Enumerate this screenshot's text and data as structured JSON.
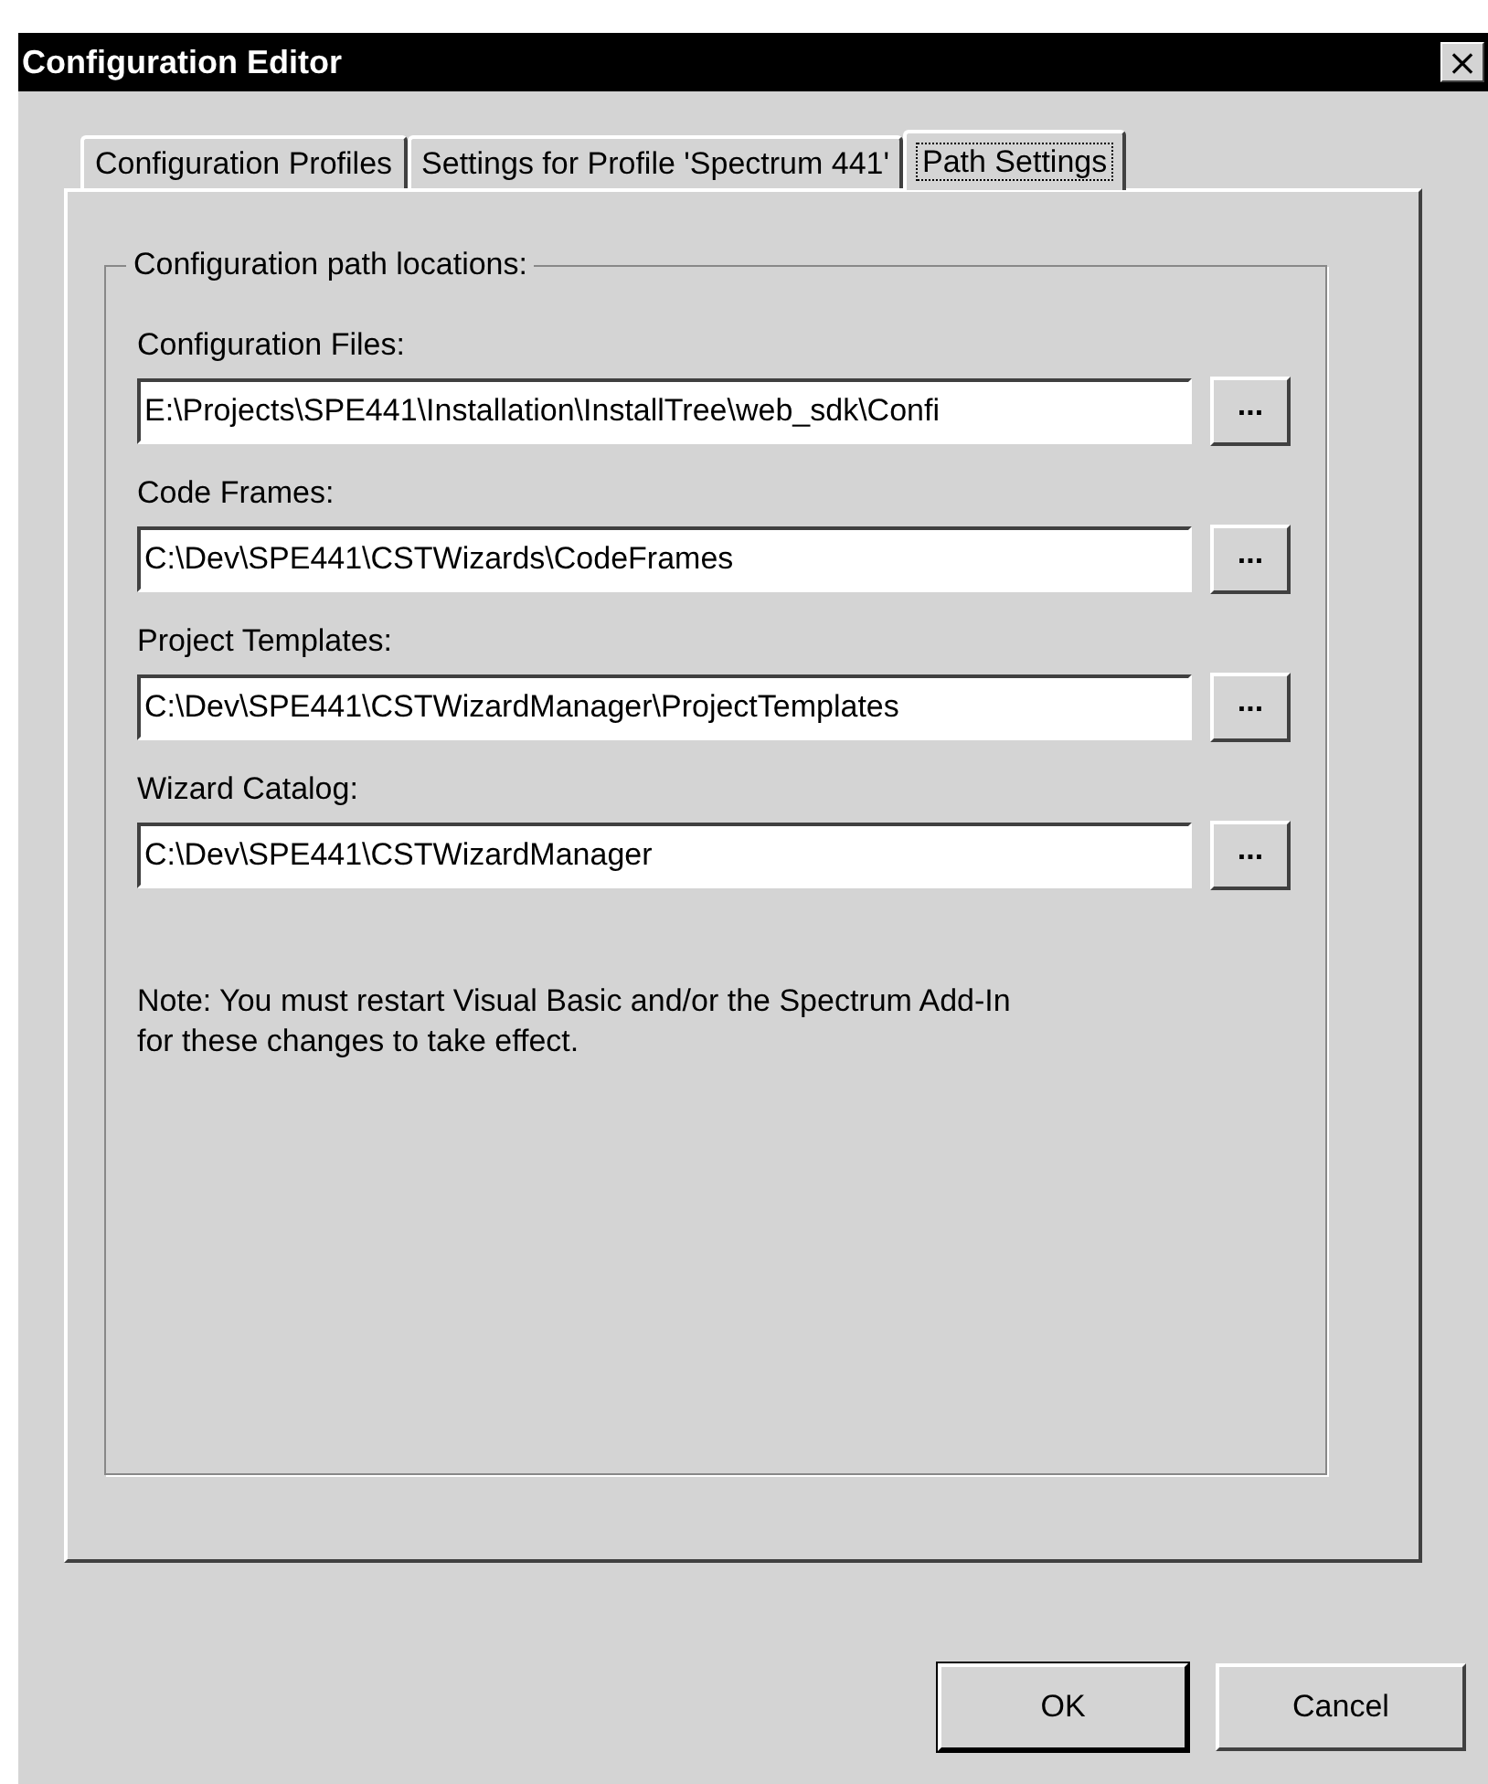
{
  "window": {
    "title": "Configuration Editor",
    "close": "×"
  },
  "tabs": [
    {
      "label": "Configuration Profiles",
      "selected": false
    },
    {
      "label": "Settings for Profile 'Spectrum 441'",
      "selected": false
    },
    {
      "label": "Path Settings",
      "selected": true
    }
  ],
  "group": {
    "title": "Configuration path locations:",
    "fields": [
      {
        "label": "Configuration Files:",
        "value": "E:\\Projects\\SPE441\\Installation\\InstallTree\\web_sdk\\Confi",
        "browse": "..."
      },
      {
        "label": "Code Frames:",
        "value": "C:\\Dev\\SPE441\\CSTWizards\\CodeFrames",
        "browse": "..."
      },
      {
        "label": "Project Templates:",
        "value": "C:\\Dev\\SPE441\\CSTWizardManager\\ProjectTemplates",
        "browse": "..."
      },
      {
        "label": "Wizard Catalog:",
        "value": "C:\\Dev\\SPE441\\CSTWizardManager",
        "browse": "..."
      }
    ],
    "note": "Note: You must restart Visual Basic and/or the Spectrum Add-In for these changes to take effect."
  },
  "buttons": [
    {
      "label": "OK",
      "default": true
    },
    {
      "label": "Cancel",
      "default": false
    }
  ]
}
